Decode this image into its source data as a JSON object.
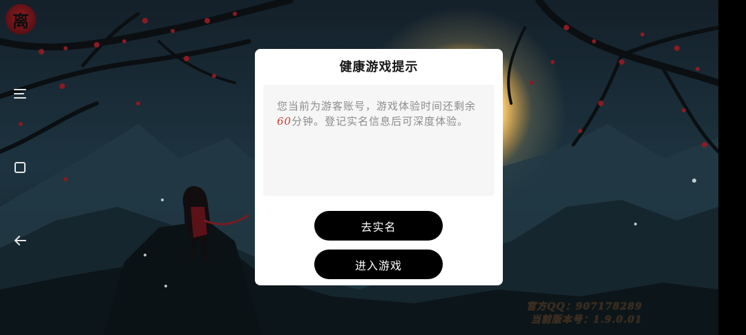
{
  "game": {
    "logo_text": "离"
  },
  "system_nav": {
    "menu_icon": "menu-icon",
    "home_icon": "square-home-icon",
    "back_icon": "back-arrow-icon"
  },
  "dialog": {
    "title": "健康游戏提示",
    "message_before": "您当前为游客账号，游戏体验时间还剩余",
    "minutes": "60",
    "message_after": "分钟。登记实名信息后可深度体验。",
    "highlight_color": "#c0392b",
    "button_realname": "去实名",
    "button_enter": "进入游戏"
  },
  "footer": {
    "qq_label": "官方QQ：",
    "qq_value": "907178289",
    "version_label": "当前版本号：",
    "version_value": "1.9.0.01"
  }
}
